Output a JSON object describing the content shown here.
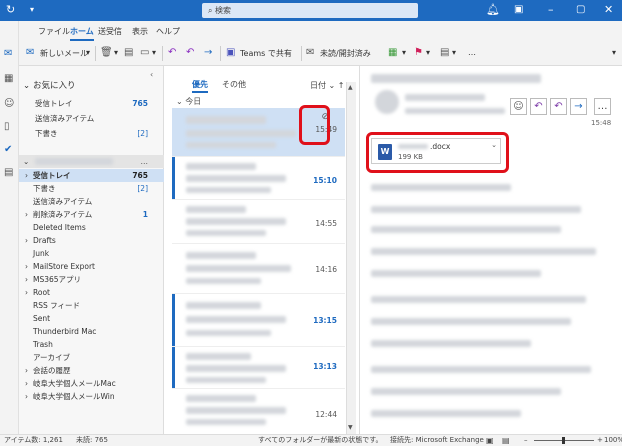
{
  "titlebar": {
    "search_placeholder": "検索",
    "bg_color": "#1e6ac0"
  },
  "menu": {
    "file": "ファイル",
    "home": "ホーム",
    "send_receive": "送受信",
    "view": "表示",
    "help": "ヘルプ"
  },
  "ribbon": {
    "new_mail": "新しいメール",
    "teams_share": "Teams で共有",
    "unread_read": "未読/開封済み",
    "more": "…"
  },
  "favorites": {
    "header": "お気に入り",
    "items": [
      {
        "name": "受信トレイ",
        "count": "765"
      },
      {
        "name": "送信済みアイテム",
        "count": ""
      },
      {
        "name": "下書き",
        "count": "[2]"
      }
    ]
  },
  "account": {
    "more": "…",
    "folders": [
      {
        "name": "受信トレイ",
        "count": "765"
      },
      {
        "name": "下書き",
        "count": "[2]"
      },
      {
        "name": "送信済みアイテム",
        "count": ""
      },
      {
        "name": "削除済みアイテム",
        "count": "1"
      },
      {
        "name": "Deleted Items",
        "count": ""
      },
      {
        "name": "Drafts",
        "count": ""
      },
      {
        "name": "Junk",
        "count": ""
      },
      {
        "name": "MailStore Export",
        "count": ""
      },
      {
        "name": "MS365アプリ",
        "count": ""
      },
      {
        "name": "Root",
        "count": ""
      },
      {
        "name": "RSS フィード",
        "count": ""
      },
      {
        "name": "Sent",
        "count": ""
      },
      {
        "name": "Thunderbird Mac",
        "count": ""
      },
      {
        "name": "Trash",
        "count": ""
      },
      {
        "name": "アーカイブ",
        "count": ""
      },
      {
        "name": "会話の履歴",
        "count": ""
      },
      {
        "name": "岐阜大学個人メールMac",
        "count": ""
      },
      {
        "name": "岐阜大学個人メールWin",
        "count": ""
      }
    ]
  },
  "list": {
    "tab_focused": "優先",
    "tab_other": "その他",
    "sort": "日付",
    "group_today": "今日",
    "messages": [
      {
        "time": "15:49"
      },
      {
        "time": "15:10"
      },
      {
        "time": "14:55"
      },
      {
        "time": "14:16"
      },
      {
        "time": "13:15"
      },
      {
        "time": "13:13"
      },
      {
        "time": "12:44"
      }
    ]
  },
  "reading": {
    "header_time": "15:48",
    "attachment_name": ".docx",
    "attachment_size": "199 KB",
    "word_icon_letter": "W"
  },
  "status": {
    "items_count": "アイテム数: 1,261",
    "unread_count": "未読: 765",
    "sync_status": "すべてのフォルダーが最新の状態です。",
    "connection": "接続先: Microsoft Exchange",
    "zoom": "100%"
  },
  "colors": {
    "accent": "#1e6ac0",
    "highlight": "#e0101a",
    "selection": "#cfe0f4"
  }
}
